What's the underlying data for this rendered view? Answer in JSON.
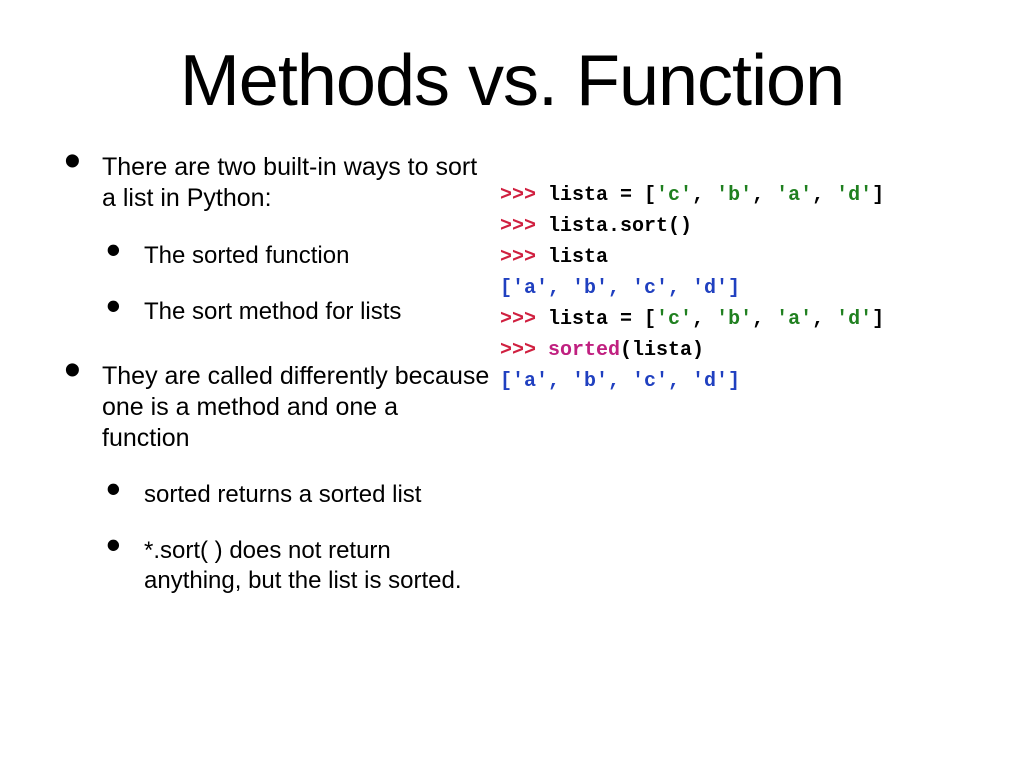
{
  "title": "Methods vs. Function",
  "bullets": {
    "b1": "There are two built-in ways to sort a list in Python:",
    "b1s1": "The sorted function",
    "b1s2": "The sort method for lists",
    "b2": "They are called differently because one is a method and one a function",
    "b2s1": "sorted returns a sorted list",
    "b2s2": "*.sort( ) does not return anything, but the list is sorted."
  },
  "code": {
    "l1": {
      "prompt": ">>> ",
      "text1": "lista = [",
      "s1": "'c'",
      "c1": ", ",
      "s2": "'b'",
      "c2": ", ",
      "s3": "'a'",
      "c3": ", ",
      "s4": "'d'",
      "text2": "]"
    },
    "l2": {
      "prompt": ">>> ",
      "text": "lista.sort()"
    },
    "l3": {
      "prompt": ">>> ",
      "text": "lista"
    },
    "l4": {
      "out": "['a', 'b', 'c', 'd']"
    },
    "l5": {
      "prompt": ">>> ",
      "text1": "lista = [",
      "s1": "'c'",
      "c1": ", ",
      "s2": "'b'",
      "c2": ", ",
      "s3": "'a'",
      "c3": ", ",
      "s4": "'d'",
      "text2": "]"
    },
    "l6": {
      "prompt": ">>> ",
      "fn": "sorted",
      "text": "(lista)"
    },
    "l7": {
      "out": "['a', 'b', 'c', 'd']"
    }
  }
}
